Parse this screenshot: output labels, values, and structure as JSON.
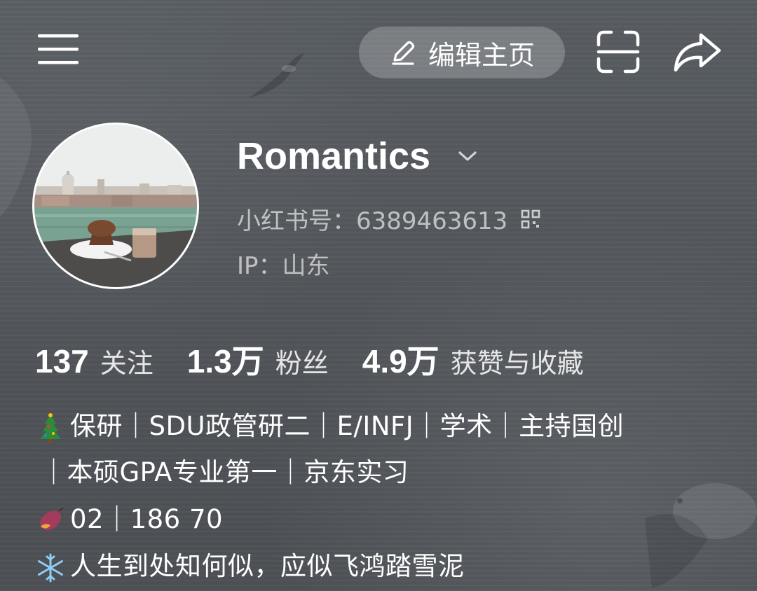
{
  "header": {
    "menu_icon": "menu-icon",
    "edit_label": "编辑主页",
    "edit_icon": "pencil-icon",
    "scan_icon": "scan-icon",
    "share_icon": "share-icon"
  },
  "profile": {
    "name": "Romantics",
    "id_label": "小红书号：",
    "id_value": "6389463613",
    "ip_label": "IP：",
    "ip_value": "山东"
  },
  "stats": [
    {
      "value": "137",
      "label": "关注"
    },
    {
      "value": "1.3万",
      "label": "粉丝"
    },
    {
      "value": "4.9万",
      "label": "获赞与收藏"
    }
  ],
  "bio": {
    "line1": "保研｜SDU政管研二｜E/INFJ｜学术｜主持国创",
    "line2": "｜本硕GPA专业第一｜京东实习",
    "line3": "02｜186 70",
    "line4": "人生到处知何似，应似飞鸿踏雪泥"
  },
  "colors": {
    "background": "#55595e",
    "edit_button_bg": "rgba(255,255,255,0.22)",
    "muted_text": "rgba(255,255,255,0.62)"
  }
}
